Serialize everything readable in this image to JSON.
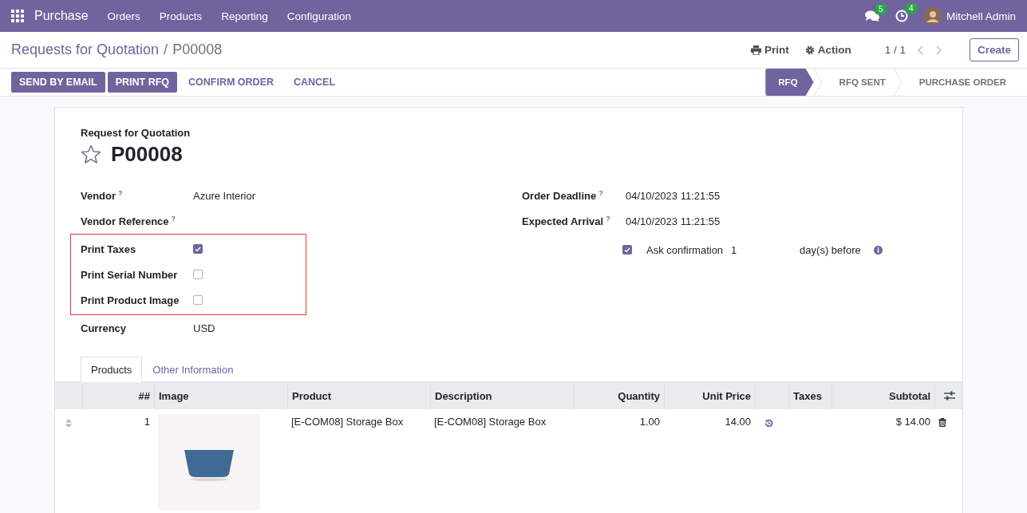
{
  "navbar": {
    "app": "Purchase",
    "menu": [
      "Orders",
      "Products",
      "Reporting",
      "Configuration"
    ],
    "messages_count": "5",
    "activities_count": "4",
    "user": "Mitchell Admin"
  },
  "breadcrumb": {
    "parent": "Requests for Quotation",
    "separator": "/",
    "current": "P00008"
  },
  "toolbar": {
    "print": "Print",
    "action": "Action",
    "pager": "1 / 1",
    "create": "Create"
  },
  "actions": [
    {
      "label": "SEND BY EMAIL",
      "kind": "primary"
    },
    {
      "label": "PRINT RFQ",
      "kind": "primary"
    },
    {
      "label": "CONFIRM ORDER",
      "kind": "link"
    },
    {
      "label": "CANCEL",
      "kind": "link"
    }
  ],
  "status_bar": [
    {
      "label": "RFQ",
      "selected": true
    },
    {
      "label": "RFQ SENT",
      "selected": false
    },
    {
      "label": "PURCHASE ORDER",
      "selected": false
    }
  ],
  "form": {
    "subtitle": "Request for Quotation",
    "title": "P00008",
    "starred": false,
    "left_fields": [
      {
        "label": "Vendor",
        "help": "?",
        "kind": "text",
        "value": "Azure Interior"
      },
      {
        "label": "Vendor Reference",
        "help": "?",
        "kind": "text"
      },
      {
        "label": "Print Taxes",
        "kind": "checkbox",
        "checked": true,
        "highlighted": true
      },
      {
        "label": "Print Serial Number",
        "kind": "checkbox",
        "checked": false,
        "highlighted": true
      },
      {
        "label": "Print Product Image",
        "kind": "checkbox",
        "checked": false,
        "highlighted": true
      },
      {
        "label": "Currency",
        "kind": "text",
        "value": "USD"
      }
    ],
    "right_fields": [
      {
        "label": "Order Deadline",
        "help": "?",
        "value": "04/10/2023 11:21:55"
      },
      {
        "label": "Expected Arrival",
        "help": "?",
        "value": "04/10/2023 11:21:55"
      }
    ],
    "confirmation": {
      "checked": true,
      "label": "Ask confirmation",
      "days": "1",
      "suffix": "day(s) before"
    }
  },
  "tabs": [
    {
      "label": "Products",
      "selected": true
    },
    {
      "label": "Other Information",
      "selected": false
    }
  ],
  "table": {
    "columns": {
      "number": "##",
      "image": "Image",
      "product": "Product",
      "description": "Description",
      "quantity": "Quantity",
      "unit_price": "Unit Price",
      "taxes": "Taxes",
      "subtotal": "Subtotal"
    },
    "rows": [
      {
        "number": "1",
        "product": "[E-COM08] Storage Box",
        "description": "[E-COM08] Storage Box",
        "quantity": "1.00",
        "unit_price": "14.00",
        "subtotal": "$ 14.00"
      }
    ]
  }
}
